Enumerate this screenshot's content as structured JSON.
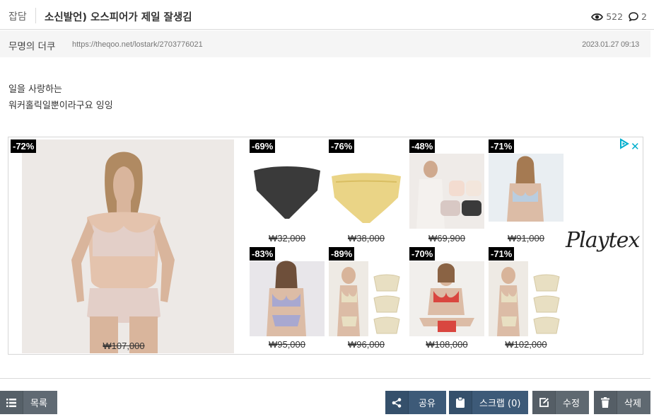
{
  "post": {
    "category": "잡담",
    "title": "소신발언) 오스피어가 제일 잘생김",
    "views": "522",
    "comments": "2",
    "author": "무명의 더쿠",
    "url": "https://theqoo.net/lostark/2703776021",
    "date": "2023.01.27 09:13",
    "body_lines": [
      "일을 사랑하는",
      "워커홀릭일뿐이라구요 잉잉"
    ]
  },
  "ad": {
    "brand": "Playtex",
    "products": [
      {
        "discount": "-72%",
        "price": "₩107,000",
        "color": "#e3cfc8"
      },
      {
        "discount": "-69%",
        "price": "₩32,000",
        "color": "#3a3a3a"
      },
      {
        "discount": "-76%",
        "price": "₩38,000",
        "color": "#ead486"
      },
      {
        "discount": "-48%",
        "price": "₩69,900",
        "color": "#d8c8c4"
      },
      {
        "discount": "-71%",
        "price": "₩91,000",
        "color": "#b9cde0"
      },
      {
        "discount": "-83%",
        "price": "₩95,000",
        "color": "#a8a8d0"
      },
      {
        "discount": "-89%",
        "price": "₩96,000",
        "color": "#e8dfc2"
      },
      {
        "discount": "-70%",
        "price": "₩108,000",
        "color": "#d9463f"
      },
      {
        "discount": "-71%",
        "price": "₩102,000",
        "color": "#e8dfc2"
      }
    ]
  },
  "actions": {
    "list": "목록",
    "share": "공유",
    "scrap": "스크랩 (0)",
    "edit": "수정",
    "delete": "삭제"
  },
  "colors": {
    "blue_button": "#3d5a78",
    "gray_button": "#5f6971",
    "ad_accent": "#00aecd"
  }
}
